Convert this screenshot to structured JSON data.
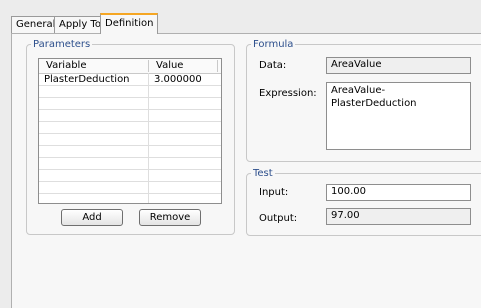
{
  "tabs": [
    {
      "label": "General"
    },
    {
      "label": "Apply To"
    },
    {
      "label": "Definition"
    }
  ],
  "parameters": {
    "title": "Parameters",
    "columns": [
      "Variable",
      "Value"
    ],
    "rows": [
      {
        "variable": "PlasterDeduction",
        "value": "3.000000"
      }
    ],
    "add_label": "Add",
    "remove_label": "Remove"
  },
  "formula": {
    "title": "Formula",
    "data_label": "Data:",
    "data_value": "AreaValue",
    "expression_label": "Expression:",
    "expression_value": "AreaValue-PlasterDeduction"
  },
  "test": {
    "title": "Test",
    "input_label": "Input:",
    "input_value": "100.00",
    "output_label": "Output:",
    "output_value": "97.00"
  },
  "colors": {
    "active_tab_accent": "#f5a623",
    "group_title": "#2d4f8c"
  }
}
